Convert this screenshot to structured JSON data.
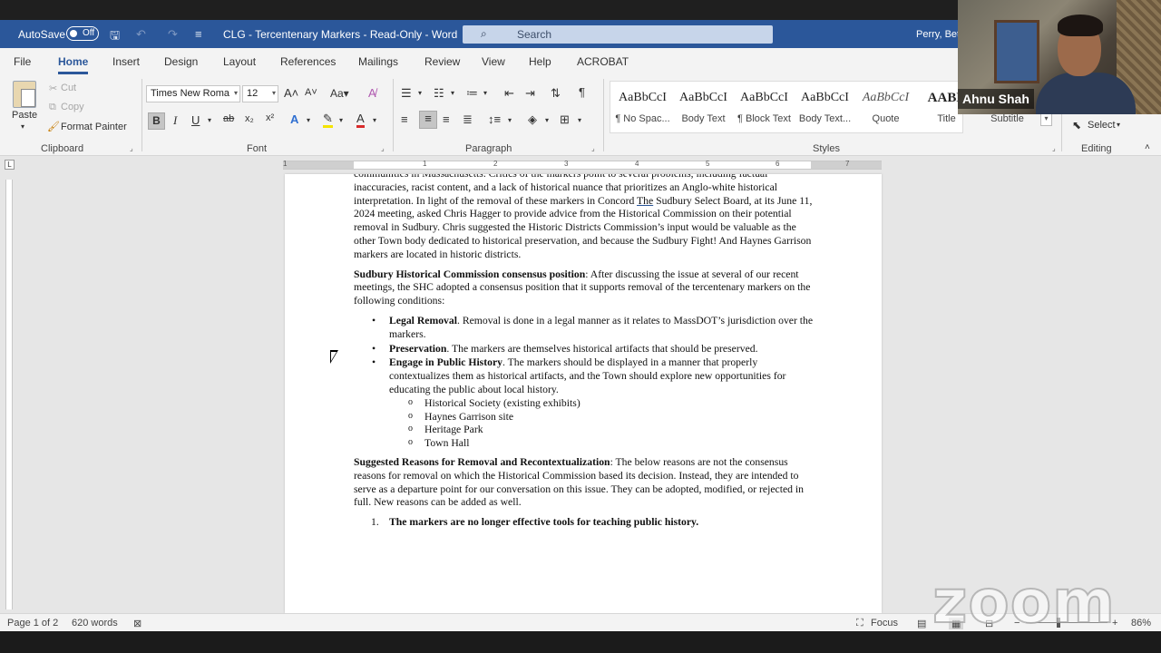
{
  "titlebar": {
    "autosave_label": "AutoSave",
    "autosave_state": "Off",
    "doc_title": "CLG - Tercentenary Markers  -  Read-Only  -  Word",
    "search_placeholder": "Search",
    "user_name": "Perry, Bet"
  },
  "tabs": [
    "File",
    "Home",
    "Insert",
    "Design",
    "Layout",
    "References",
    "Mailings",
    "Review",
    "View",
    "Help",
    "ACROBAT"
  ],
  "ribbon": {
    "clipboard": {
      "paste": "Paste",
      "cut": "Cut",
      "copy": "Copy",
      "format_painter": "Format Painter",
      "label": "Clipboard"
    },
    "font": {
      "name": "Times New Roma",
      "size": "12",
      "label": "Font"
    },
    "paragraph": {
      "label": "Paragraph"
    },
    "styles": {
      "label": "Styles",
      "items": [
        {
          "preview": "AaBbCcI",
          "name": "¶ No Spac..."
        },
        {
          "preview": "AaBbCcI",
          "name": "Body Text"
        },
        {
          "preview": "AaBbCcI",
          "name": "¶ Block Text"
        },
        {
          "preview": "AaBbCcI",
          "name": "Body Text..."
        },
        {
          "preview": "AaBbCcI",
          "name": "Quote"
        },
        {
          "preview": "AABB",
          "name": "Title"
        },
        {
          "preview": "",
          "name": "Subtitle"
        }
      ]
    },
    "editing": {
      "select": "Select",
      "label": "Editing"
    }
  },
  "ruler_numbers": [
    "1",
    "1",
    "2",
    "3",
    "4",
    "5",
    "6",
    "7"
  ],
  "document": {
    "para1_a": "communities in Massachusetts.  Critics of the markers point to several problems, including factual inaccuracies, racist content, and a lack of historical nuance that prioritizes an Anglo-white historical interpretation.  In light of the removal of these markers in Concord ",
    "para1_the": "The",
    "para1_b": " Sudbury Select Board, at its June 11, 2024 meeting, asked Chris Hagger to provide advice from the Historical Commission on their potential removal in Sudbury.  Chris suggested the Historic Districts Commission’s input would be valuable as the other Town body dedicated to historical preservation, and because the Sudbury Fight! And Haynes Garrison markers are located in historic districts.",
    "consensus_heading": "Sudbury Historical Commission consensus position",
    "consensus_text": ": After discussing the issue at several of our recent meetings, the SHC adopted a consensus position that it supports removal of the tercentenary markers on the following conditions:",
    "conditions": [
      {
        "title": "Legal Removal",
        "text": ".  Removal is done in a legal manner as it relates to MassDOT’s jurisdiction over the markers."
      },
      {
        "title": "Preservation",
        "text": ".  The markers are themselves historical artifacts that should be preserved."
      },
      {
        "title": "Engage in Public History",
        "text": ".  The markers should be displayed in a manner that properly contextualizes them as historical artifacts, and the Town should explore new opportunities for educating the public about local history."
      }
    ],
    "sub_items": [
      "Historical Society (existing exhibits)",
      "Haynes Garrison site",
      "Heritage Park",
      "Town Hall"
    ],
    "reasons_heading": "Suggested Reasons for Removal and Recontextualization",
    "reasons_text": ":  The below reasons are not the consensus reasons for removal on which the Historical Commission based its decision. Instead, they are intended to serve as a departure point for our conversation on this issue.  They can be adopted, modified, or rejected in full.  New reasons can be added as well.",
    "numbered": [
      {
        "num": "1.",
        "text": "The markers are no longer effective tools for teaching public history."
      }
    ]
  },
  "statusbar": {
    "page": "Page 1 of 2",
    "words": "620 words",
    "focus": "Focus",
    "zoom": "86%"
  },
  "video": {
    "participant": "Ahnu Shah",
    "watermark": "zoom"
  }
}
